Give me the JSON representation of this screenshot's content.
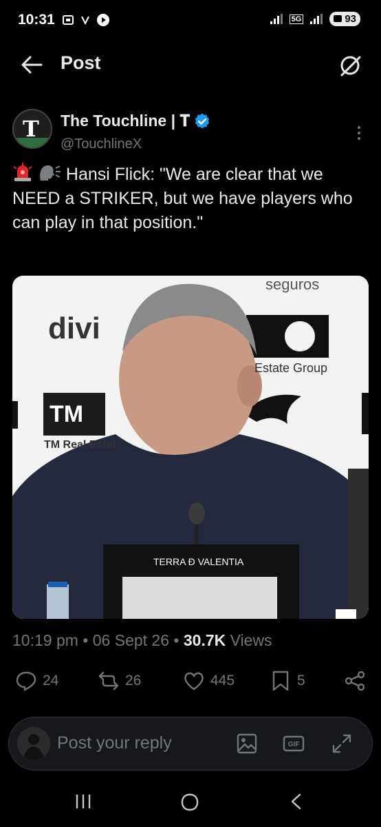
{
  "status_bar": {
    "time": "10:31",
    "network_5g": "5G",
    "battery": "93"
  },
  "header": {
    "title": "Post"
  },
  "author": {
    "display_name": "The Touchline | 𝐓",
    "handle": "@TouchlineX",
    "avatar_letter": "T"
  },
  "tweet": {
    "text": "Hansi Flick: \"We are clear that we NEED a STRIKER, but we have players who can play in that position.\"",
    "media_labels": {
      "sponsor_1": "seguros",
      "sponsor_2": "divi",
      "sponsor_3": "Estate Group",
      "sponsor_4": "TM",
      "sponsor_5": "TM Real Estat",
      "podium": "TERRA Ð VALENTIA"
    }
  },
  "meta": {
    "time": "10:19 pm",
    "date": "06 Sept 26",
    "views_count": "30.7K",
    "views_label": "Views"
  },
  "actions": {
    "replies": "24",
    "reposts": "26",
    "likes": "445",
    "bookmarks": "5"
  },
  "reply": {
    "placeholder": "Post your reply"
  },
  "colors": {
    "background": "#000000",
    "text_primary": "#e7e9ea",
    "text_secondary": "#71767b",
    "verified": "#1d9bf0"
  }
}
